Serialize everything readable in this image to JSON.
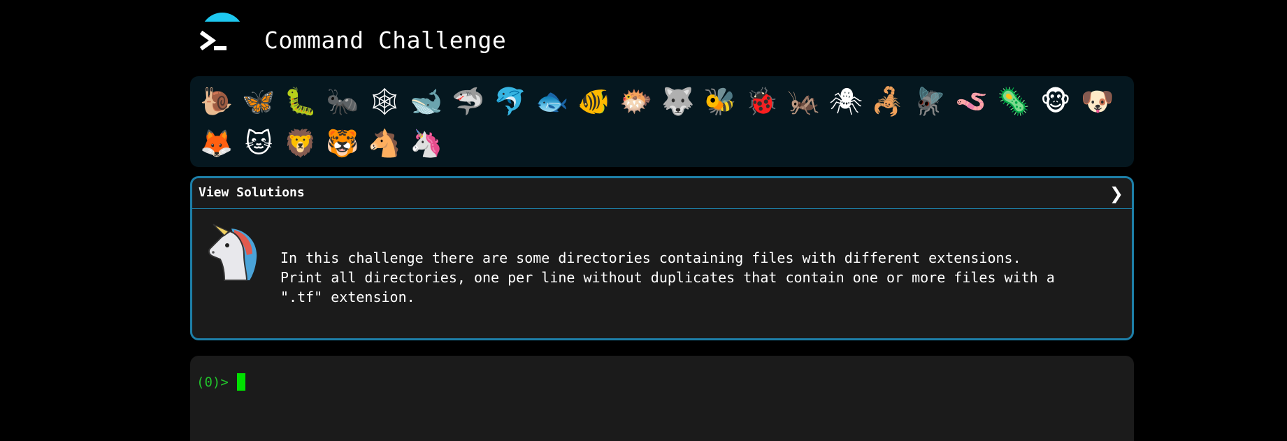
{
  "header": {
    "title": "Command Challenge",
    "logo_icon": "terminal-prompt-icon",
    "accent_color": "#1ec8f0"
  },
  "animals": [
    {
      "name": "snail",
      "glyph": "🐌"
    },
    {
      "name": "butterfly",
      "glyph": "🦋"
    },
    {
      "name": "caterpillar",
      "glyph": "🐛"
    },
    {
      "name": "ant",
      "glyph": "🐜"
    },
    {
      "name": "spider-web",
      "glyph": "🕸"
    },
    {
      "name": "whale",
      "glyph": "🐋"
    },
    {
      "name": "shark",
      "glyph": "🦈"
    },
    {
      "name": "dolphin",
      "glyph": "🐬"
    },
    {
      "name": "fish",
      "glyph": "🐟"
    },
    {
      "name": "tropical-fish",
      "glyph": "🐠"
    },
    {
      "name": "pufferfish",
      "glyph": "🐡"
    },
    {
      "name": "wolf",
      "glyph": "🐺"
    },
    {
      "name": "bee",
      "glyph": "🐝"
    },
    {
      "name": "ladybug",
      "glyph": "🐞"
    },
    {
      "name": "cricket",
      "glyph": "🦗"
    },
    {
      "name": "spider",
      "glyph": "🕷"
    },
    {
      "name": "scorpion",
      "glyph": "🦂"
    },
    {
      "name": "fly",
      "glyph": "🪰"
    },
    {
      "name": "worm",
      "glyph": "🪱"
    },
    {
      "name": "microbe",
      "glyph": "🦠"
    },
    {
      "name": "monkey",
      "glyph": "🐵"
    },
    {
      "name": "dog",
      "glyph": "🐶"
    },
    {
      "name": "fox",
      "glyph": "🦊"
    },
    {
      "name": "cat",
      "glyph": "🐱"
    },
    {
      "name": "lion",
      "glyph": "🦁"
    },
    {
      "name": "tiger",
      "glyph": "🐯"
    },
    {
      "name": "horse",
      "glyph": "🐴"
    },
    {
      "name": "unicorn",
      "glyph": "🦄"
    }
  ],
  "solutions": {
    "title": "View Solutions",
    "chevron": "❯",
    "border_color": "#1d7fa8",
    "challenge_icon": "unicorn-icon",
    "description": "In this challenge there are some directories containing files with different extensions.\nPrint all directories, one per line without duplicates that contain one or more files with a\n\".tf\" extension."
  },
  "terminal": {
    "prompt": "(0)>",
    "prompt_color": "#21c42b",
    "input_value": ""
  }
}
